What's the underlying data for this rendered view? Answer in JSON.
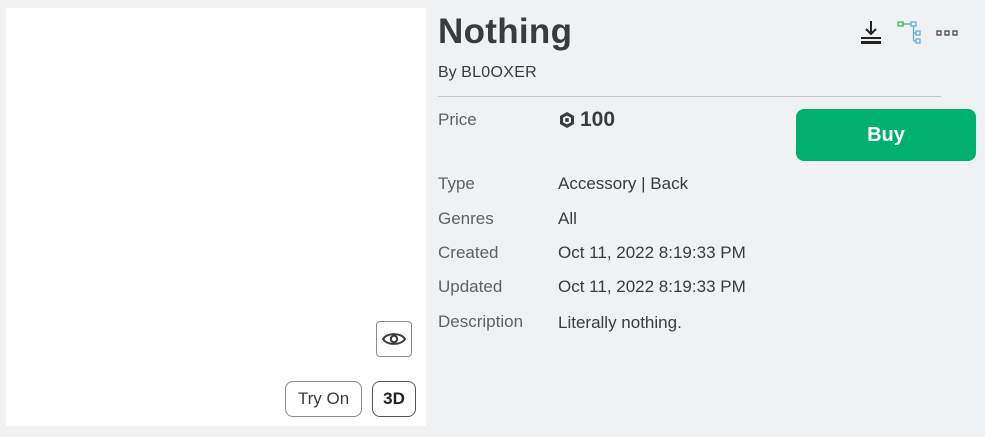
{
  "item": {
    "title": "Nothing",
    "by_prefix": "By",
    "creator": "BL0OXER"
  },
  "preview": {
    "try_on_label": "Try On",
    "three_d_label": "3D",
    "toggle_icon": "eye-icon"
  },
  "toolbar": {
    "icons": [
      "download-icon",
      "hierarchy-icon",
      "more-options-icon"
    ]
  },
  "details": {
    "price_label": "Price",
    "price_value": "100",
    "currency_icon": "robux-icon",
    "buy_label": "Buy",
    "type_label": "Type",
    "type_value": "Accessory | Back",
    "genres_label": "Genres",
    "genres_value": "All",
    "created_label": "Created",
    "created_value": "Oct 11, 2022 8:19:33 PM",
    "updated_label": "Updated",
    "updated_value": "Oct 11, 2022 8:19:33 PM",
    "description_label": "Description",
    "description_value": "Literally nothing."
  },
  "colors": {
    "buy_button": "#00b06f",
    "page_background": "#f0f1f2",
    "text": "#393b3d"
  }
}
